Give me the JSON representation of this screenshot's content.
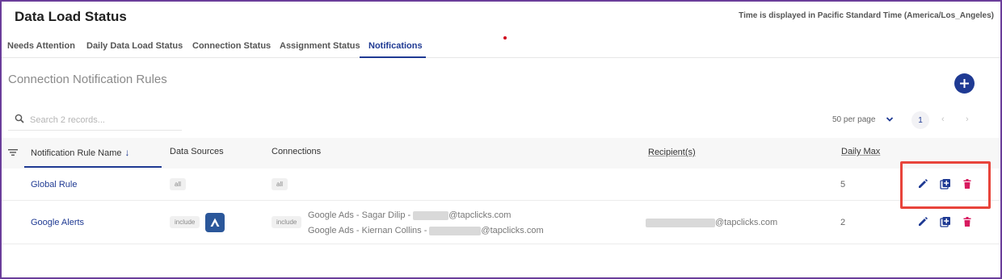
{
  "header": {
    "title": "Data Load Status",
    "timezone_note": "Time is displayed in Pacific Standard Time (America/Los_Angeles)"
  },
  "tabs": [
    {
      "label": "Needs Attention"
    },
    {
      "label": "Daily Data Load Status"
    },
    {
      "label": "Connection Status"
    },
    {
      "label": "Assignment Status"
    },
    {
      "label": "Notifications",
      "active": true
    }
  ],
  "section": {
    "title": "Connection Notification Rules"
  },
  "search": {
    "placeholder": "Search 2 records..."
  },
  "pagination": {
    "per_page": "50 per page",
    "current_page": "1",
    "prev": "‹",
    "next": "›"
  },
  "table": {
    "columns": {
      "name": "Notification Rule Name",
      "data_sources": "Data Sources",
      "connections": "Connections",
      "recipients": "Recipient(s)",
      "daily_max": "Daily Max"
    },
    "rows": [
      {
        "name": "Global Rule",
        "data_sources_mode": "all",
        "connections_mode": "all",
        "connections": [],
        "recipient": "",
        "daily_max": "5"
      },
      {
        "name": "Google Alerts",
        "data_sources_mode": "include",
        "connections_mode": "include",
        "connections": [
          {
            "prefix": "Google Ads - Sagar Dilip - ",
            "domain": "@tapclicks.com"
          },
          {
            "prefix": "Google Ads - Kiernan Collins - ",
            "domain": "@tapclicks.com"
          }
        ],
        "recipient": "@tapclicks.com",
        "daily_max": "2"
      }
    ]
  },
  "icons": {
    "add": "plus-icon",
    "search": "search-icon",
    "filter": "filter-icon",
    "edit": "pencil-icon",
    "copy": "copy-add-icon",
    "delete": "trash-icon",
    "data_source_logo": "google-ads-logo-icon"
  },
  "colors": {
    "primary": "#1f3a93",
    "delete": "#d81b60",
    "highlight": "#e8443b",
    "frame": "#6a3d9a"
  }
}
